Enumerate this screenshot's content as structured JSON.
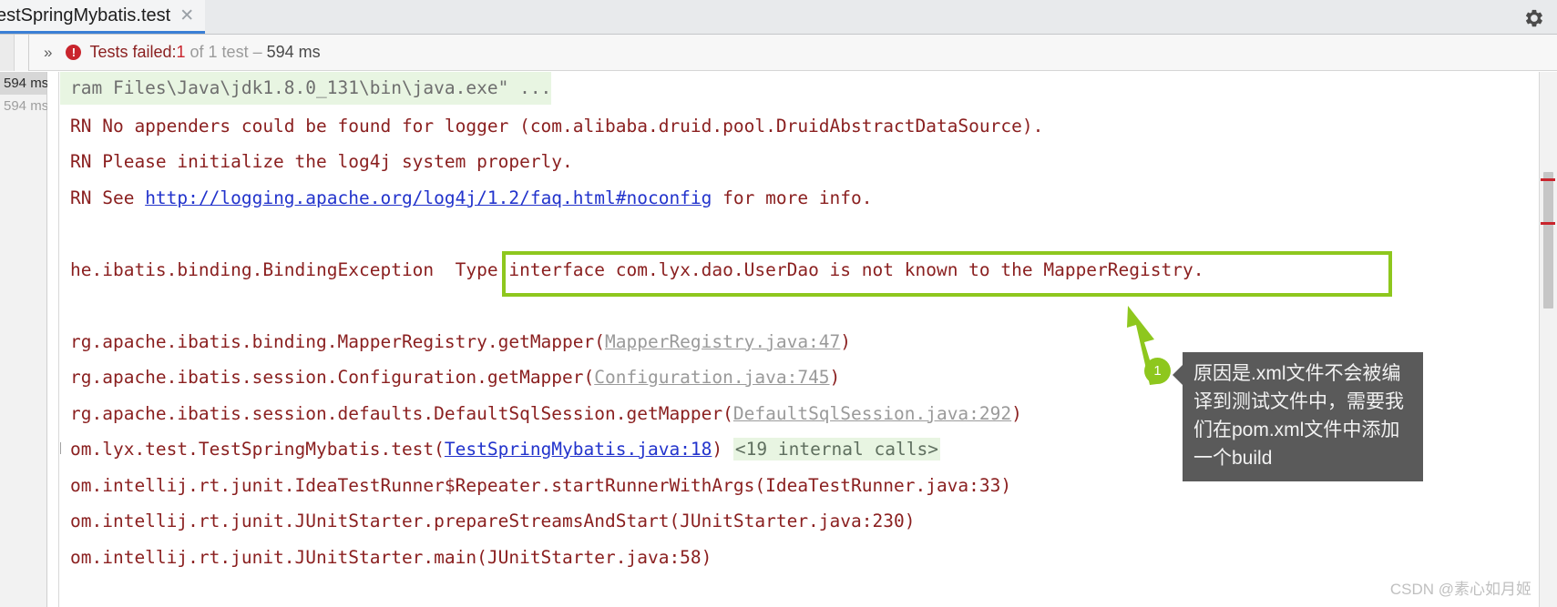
{
  "window": {
    "tab": {
      "label": "estSpringMybatis.test",
      "close_icon": "close-icon"
    },
    "settings_icon": "gear-icon"
  },
  "status": {
    "expand_icon": "»",
    "error_icon": "!",
    "failed_label": "Tests failed:",
    "failed_count": "1",
    "of_label": " of 1 test – ",
    "duration": "594 ms"
  },
  "sidebar": {
    "items": [
      {
        "label": "594 ms",
        "selected": true
      },
      {
        "label": "594 ms",
        "selected": false
      }
    ]
  },
  "console": {
    "lines": [
      {
        "id": "line-java-cmd",
        "highlight": true,
        "segments": [
          {
            "text": "ram Files\\Java\\jdk1.8.0_131\\bin\\java.exe\" ...",
            "style": "gray"
          }
        ]
      },
      {
        "id": "line-log4j-no-appenders",
        "highlight": false,
        "segments": [
          {
            "text": "RN No appenders could be found for logger (com.alibaba.druid.pool.DruidAbstractDataSource).",
            "style": "red"
          }
        ]
      },
      {
        "id": "line-log4j-initialize",
        "highlight": false,
        "segments": [
          {
            "text": "RN Please initialize the log4j system properly.",
            "style": "red"
          }
        ]
      },
      {
        "id": "line-log4j-see",
        "highlight": false,
        "segments": [
          {
            "text": "RN See ",
            "style": "red"
          },
          {
            "text": "http://logging.apache.org/log4j/1.2/faq.html#noconfig",
            "style": "link-blue"
          },
          {
            "text": " for more info.",
            "style": "red"
          }
        ]
      },
      {
        "id": "line-blank-1",
        "highlight": false,
        "segments": [
          {
            "text": " ",
            "style": "red"
          }
        ]
      },
      {
        "id": "line-binding-exception",
        "highlight": false,
        "segments": [
          {
            "text": "he.ibatis.binding.BindingException",
            "style": "red"
          },
          {
            "text": "  Type interface com.lyx.dao.UserDao is not known to the MapperRegistry.",
            "style": "red"
          }
        ]
      },
      {
        "id": "line-blank-2",
        "highlight": false,
        "segments": [
          {
            "text": " ",
            "style": "red"
          }
        ]
      },
      {
        "id": "line-mapperregistry",
        "highlight": false,
        "segments": [
          {
            "text": "rg.apache.ibatis.binding.MapperRegistry.getMapper(",
            "style": "red"
          },
          {
            "text": "MapperRegistry.java:47",
            "style": "link-gray"
          },
          {
            "text": ")",
            "style": "red"
          }
        ]
      },
      {
        "id": "line-configuration",
        "highlight": false,
        "segments": [
          {
            "text": "rg.apache.ibatis.session.Configuration.getMapper(",
            "style": "red"
          },
          {
            "text": "Configuration.java:745",
            "style": "link-gray"
          },
          {
            "text": ")",
            "style": "red"
          }
        ]
      },
      {
        "id": "line-defaultsqlsession",
        "highlight": false,
        "segments": [
          {
            "text": "rg.apache.ibatis.session.defaults.DefaultSqlSession.getMapper(",
            "style": "red"
          },
          {
            "text": "DefaultSqlSession.java:292",
            "style": "link-gray"
          },
          {
            "text": ")",
            "style": "red"
          }
        ]
      },
      {
        "id": "line-testspringmybatis",
        "highlight": false,
        "expander": true,
        "segments": [
          {
            "text": "om.lyx.test.TestSpringMybatis.test(",
            "style": "red"
          },
          {
            "text": "TestSpringMybatis.java:18",
            "style": "link-blue"
          },
          {
            "text": ") ",
            "style": "red"
          },
          {
            "text": "<19 internal calls>",
            "style": "internal"
          }
        ]
      },
      {
        "id": "line-ideatestrunner",
        "highlight": false,
        "segments": [
          {
            "text": "om.intellij.rt.junit.IdeaTestRunner$Repeater.startRunnerWithArgs(IdeaTestRunner.java:33)",
            "style": "red"
          }
        ]
      },
      {
        "id": "line-junitstarter-prepare",
        "highlight": false,
        "segments": [
          {
            "text": "om.intellij.rt.junit.JUnitStarter.prepareStreamsAndStart(JUnitStarter.java:230)",
            "style": "red"
          }
        ]
      },
      {
        "id": "line-junitstarter-main",
        "highlight": false,
        "segments": [
          {
            "text": "om.intellij.rt.junit.JUnitStarter.main(JUnitStarter.java:58)",
            "style": "red"
          }
        ]
      }
    ]
  },
  "annotation": {
    "badge_number": "1",
    "tooltip_text": "原因是.xml文件不会被编译到测试文件中，需要我们在pom.xml文件中添加一个build",
    "highlight_color": "#8ec71e",
    "tooltip_bg": "#5a5a5a"
  },
  "watermark": {
    "text": "CSDN @素心如月姬"
  }
}
